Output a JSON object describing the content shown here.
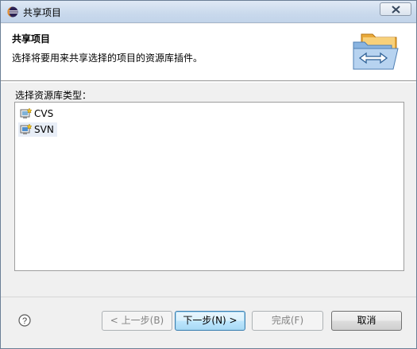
{
  "window": {
    "title": "共享项目"
  },
  "banner": {
    "title": "共享项目",
    "description": "选择将要用来共享选择的项目的资源库插件。",
    "graphic_icon": "share-project-folders-icon"
  },
  "list": {
    "label": "选择资源库类型：",
    "items": [
      {
        "label": "CVS",
        "icon": "cvs-repository-icon",
        "selected": false
      },
      {
        "label": "SVN",
        "icon": "svn-repository-icon",
        "selected": true
      }
    ]
  },
  "buttons": {
    "back": "< 上一步(B)",
    "next": "下一步(N) >",
    "finish": "完成(F)",
    "cancel": "取消"
  },
  "colors": {
    "selection": "#e8eef7",
    "titlebar": "#c9d9ec",
    "default_button_border": "#3c7fb1"
  }
}
